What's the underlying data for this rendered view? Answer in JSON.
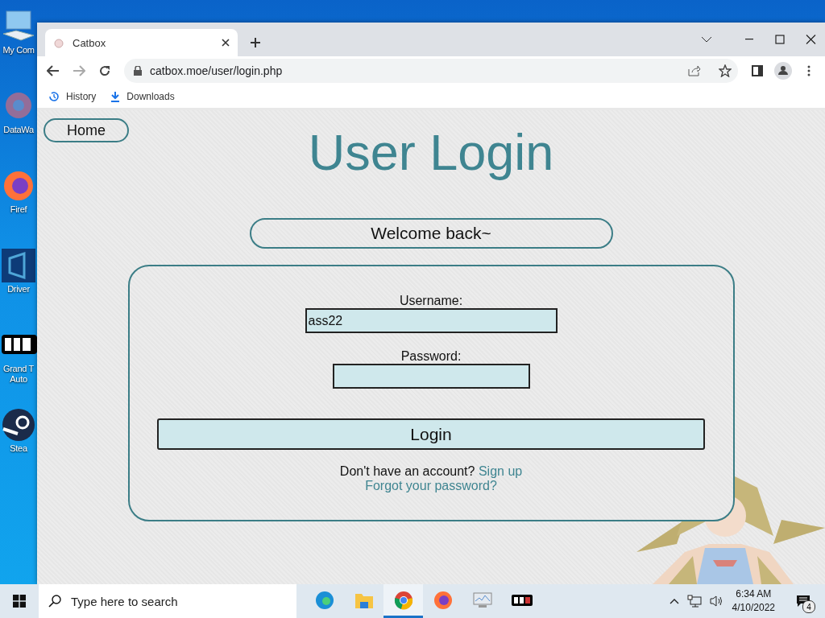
{
  "desktop": {
    "icons": [
      {
        "kind": "computer",
        "lines": [
          "My Com"
        ]
      },
      {
        "kind": "data",
        "lines": [
          "DataWa"
        ]
      },
      {
        "kind": "firefox",
        "lines": [
          "Firef"
        ]
      },
      {
        "kind": "driver",
        "lines": [
          "Driver"
        ]
      },
      {
        "kind": "gta",
        "lines": [
          "Grand T",
          "Auto"
        ]
      },
      {
        "kind": "steam",
        "lines": [
          "Stea"
        ]
      }
    ]
  },
  "browser": {
    "tab": {
      "title": "Catbox"
    },
    "address": "catbox.moe/user/login.php",
    "bookmarks": [
      {
        "kind": "history",
        "label": "History"
      },
      {
        "kind": "download",
        "label": "Downloads"
      }
    ]
  },
  "page": {
    "home": "Home",
    "title": "User Login",
    "welcome": "Welcome back~",
    "form": {
      "username_label": "Username:",
      "username_value": "ass22",
      "password_label": "Password:",
      "login": "Login",
      "signup_prompt": "Don't have an account?",
      "signup_link": "Sign up",
      "forgot_link": "Forgot your password?"
    }
  },
  "taskbar": {
    "search_placeholder": "Type here to search",
    "apps": [
      {
        "kind": "edge",
        "selected": false
      },
      {
        "kind": "explorer",
        "selected": false
      },
      {
        "kind": "chrome",
        "selected": true
      },
      {
        "kind": "firefox",
        "selected": false
      },
      {
        "kind": "monitor",
        "selected": false
      },
      {
        "kind": "gta",
        "selected": false
      }
    ],
    "time": "6:34 AM",
    "date": "4/10/2022",
    "notifications": "4"
  }
}
